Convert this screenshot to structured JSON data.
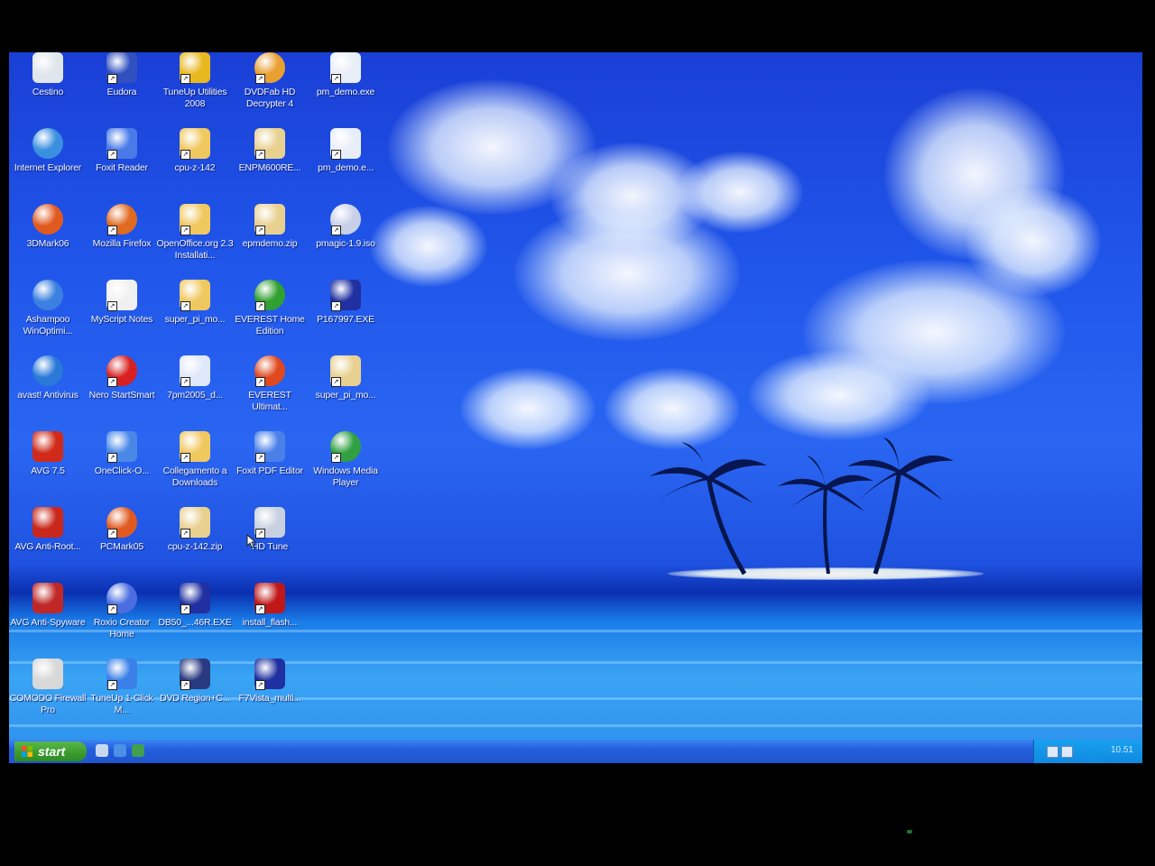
{
  "desktop": {
    "icons": [
      {
        "label": "Cestino",
        "icon": "recycle-bin-icon",
        "color": "#dfe6ec"
      },
      {
        "label": "Internet Explorer",
        "icon": "internet-explorer-icon",
        "color": "#3a8fe0"
      },
      {
        "label": "3DMark06",
        "icon": "3dmark-icon",
        "color": "#e05a20"
      },
      {
        "label": "Ashampoo WinOptimi...",
        "icon": "ashampoo-icon",
        "color": "#3b7fe0"
      },
      {
        "label": "avast! Antivirus",
        "icon": "avast-icon",
        "color": "#2a78d8"
      },
      {
        "label": "AVG 7.5",
        "icon": "avg-icon",
        "color": "#d02a1a"
      },
      {
        "label": "AVG Anti-Root...",
        "icon": "avg-antirootkit-icon",
        "color": "#c8281c"
      },
      {
        "label": "AVG Anti-Spyware",
        "icon": "avg-antispyware-icon",
        "color": "#c02828"
      },
      {
        "label": "COMODO Firewall Pro",
        "icon": "comodo-icon",
        "color": "#d8d8d8"
      },
      {
        "label": "Eudora",
        "icon": "eudora-icon",
        "color": "#3050c0"
      },
      {
        "label": "Foxit Reader",
        "icon": "foxit-reader-icon",
        "color": "#4a7ae8"
      },
      {
        "label": "Mozilla Firefox",
        "icon": "firefox-icon",
        "color": "#e06a20"
      },
      {
        "label": "MyScript Notes",
        "icon": "myscript-notes-icon",
        "color": "#f0f0f0"
      },
      {
        "label": "Nero StartSmart",
        "icon": "nero-icon",
        "color": "#d82020"
      },
      {
        "label": "OneClick-O...",
        "icon": "oneclick-icon",
        "color": "#4a88e8"
      },
      {
        "label": "PCMark05",
        "icon": "pcmark-icon",
        "color": "#e05a20"
      },
      {
        "label": "Roxio Creator Home",
        "icon": "roxio-icon",
        "color": "#4a6ee0"
      },
      {
        "label": "TuneUp 1-Click M...",
        "icon": "tuneup-1click-icon",
        "color": "#3a80e8"
      },
      {
        "label": "TuneUp Utilities 2008",
        "icon": "tuneup-utilities-icon",
        "color": "#e8b820"
      },
      {
        "label": "cpu-z-142",
        "icon": "folder-icon",
        "color": "#f0c860"
      },
      {
        "label": "OpenOffice.org 2.3 Installati...",
        "icon": "folder-icon",
        "color": "#f0c860"
      },
      {
        "label": "super_pi_mo...",
        "icon": "folder-icon",
        "color": "#f0c860"
      },
      {
        "label": "7pm2005_d...",
        "icon": "7pm-icon",
        "color": "#dfe8f8"
      },
      {
        "label": "Collegamento a Downloads",
        "icon": "folder-shortcut-icon",
        "color": "#f0c860"
      },
      {
        "label": "cpu-z-142.zip",
        "icon": "zip-folder-icon",
        "color": "#e8d090"
      },
      {
        "label": "DB50_...46R.EXE",
        "icon": "exe-icon",
        "color": "#2030a0"
      },
      {
        "label": "DVD Region+C...",
        "icon": "dvd-region-icon",
        "color": "#2a3a80"
      },
      {
        "label": "DVDFab HD Decrypter 4",
        "icon": "dvdfab-icon",
        "color": "#e8a030"
      },
      {
        "label": "ENPM600RE...",
        "icon": "zip-folder-icon",
        "color": "#e8d090"
      },
      {
        "label": "epmdemo.zip",
        "icon": "zip-folder-icon",
        "color": "#e8d090"
      },
      {
        "label": "EVEREST Home Edition",
        "icon": "everest-home-icon",
        "color": "#30a030"
      },
      {
        "label": "EVEREST Ultimat...",
        "icon": "everest-ultimate-icon",
        "color": "#e04820"
      },
      {
        "label": "Foxit PDF Editor",
        "icon": "foxit-pdf-editor-icon",
        "color": "#4a80e8"
      },
      {
        "label": "HD Tune",
        "icon": "hdtune-icon",
        "color": "#c8d0e0"
      },
      {
        "label": "install_flash...",
        "icon": "flash-installer-icon",
        "color": "#c01818"
      },
      {
        "label": "F7Vista_multi...",
        "icon": "exe-icon",
        "color": "#2030a0"
      },
      {
        "label": "pm_demo.exe",
        "icon": "window-app-icon",
        "color": "#e8eef8"
      },
      {
        "label": "pm_demo.e...",
        "icon": "calculator-file-icon",
        "color": "#e8eef8"
      },
      {
        "label": "pmagic-1.9.iso",
        "icon": "iso-disc-icon",
        "color": "#c8d0e8"
      },
      {
        "label": "P167997.EXE",
        "icon": "exe-icon",
        "color": "#2030a0"
      },
      {
        "label": "super_pi_mo...",
        "icon": "zip-folder-icon",
        "color": "#e8d090"
      },
      {
        "label": "Windows Media Player",
        "icon": "windows-media-player-icon",
        "color": "#30a040"
      }
    ]
  },
  "taskbar": {
    "start_label": "start",
    "quick_launch": [
      {
        "icon": "show-desktop-icon",
        "color": "#c8d8f0"
      },
      {
        "icon": "ie-quicklaunch-icon",
        "color": "#4a90e8"
      },
      {
        "icon": "media-player-quicklaunch-icon",
        "color": "#40a050"
      }
    ],
    "tray_icons": [
      "network-icon",
      "volume-icon"
    ],
    "clock": "10.51"
  },
  "colors": {
    "taskbar": "#245edb",
    "start_button": "#3a9a2e",
    "tray": "#0f8ae0"
  }
}
